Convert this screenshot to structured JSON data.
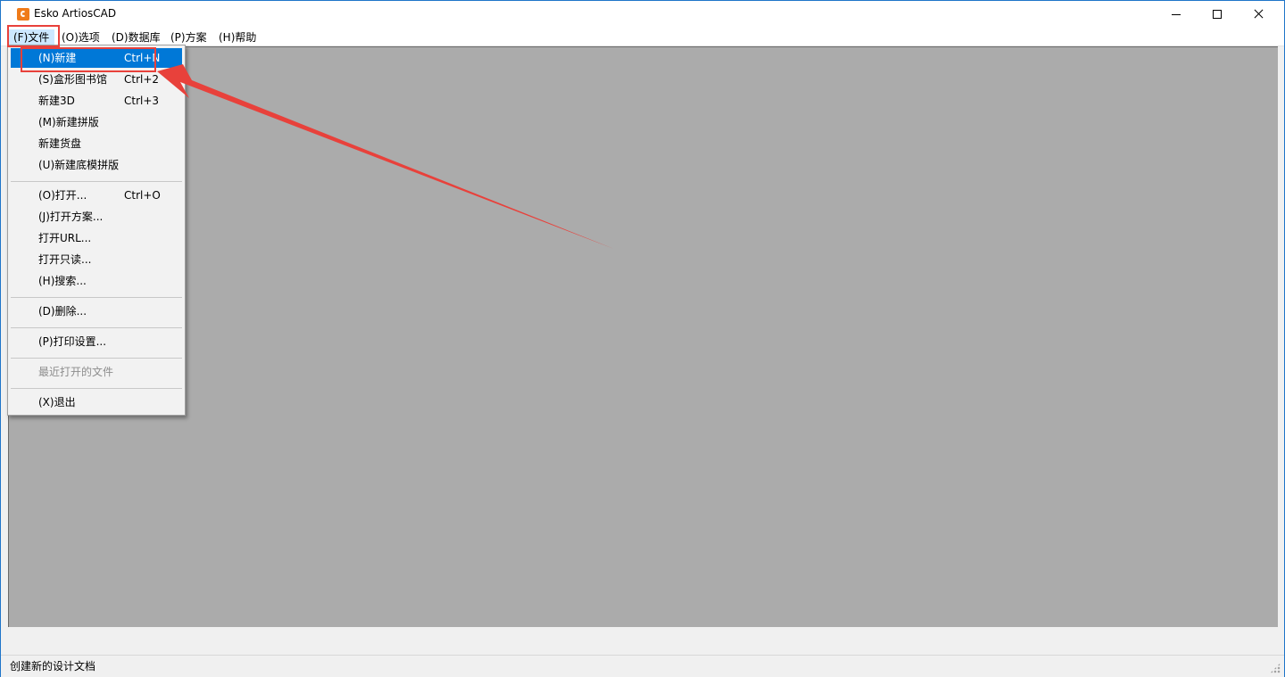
{
  "window": {
    "title": "Esko ArtiosCAD"
  },
  "menubar": {
    "items": [
      {
        "label": "(F)文件"
      },
      {
        "label": "(O)选项"
      },
      {
        "label": "(D)数据库"
      },
      {
        "label": "(P)方案"
      },
      {
        "label": "(H)帮助"
      }
    ]
  },
  "file_menu": {
    "items": [
      {
        "label": "(N)新建",
        "shortcut": "Ctrl+N",
        "highlighted": true
      },
      {
        "label": "(S)盒形图书馆",
        "shortcut": "Ctrl+2"
      },
      {
        "label": "新建3D",
        "shortcut": "Ctrl+3"
      },
      {
        "label": "(M)新建拼版",
        "shortcut": ""
      },
      {
        "label": "新建货盘",
        "shortcut": ""
      },
      {
        "label": "(U)新建底模拼版",
        "shortcut": ""
      },
      {
        "label": "(O)打开...",
        "shortcut": "Ctrl+O"
      },
      {
        "label": "(J)打开方案...",
        "shortcut": ""
      },
      {
        "label": "打开URL...",
        "shortcut": ""
      },
      {
        "label": "打开只读...",
        "shortcut": ""
      },
      {
        "label": "(H)搜索...",
        "shortcut": ""
      },
      {
        "label": "(D)删除...",
        "shortcut": ""
      },
      {
        "label": "(P)打印设置...",
        "shortcut": ""
      },
      {
        "label": "最近打开的文件",
        "shortcut": "",
        "disabled": true
      },
      {
        "label": "(X)退出",
        "shortcut": ""
      }
    ]
  },
  "statusbar": {
    "text": "创建新的设计文档"
  },
  "colors": {
    "accent": "#0078d7",
    "annotation": "#e8413b",
    "workspace": "#ababab",
    "app_icon": "#ef7b1a"
  }
}
